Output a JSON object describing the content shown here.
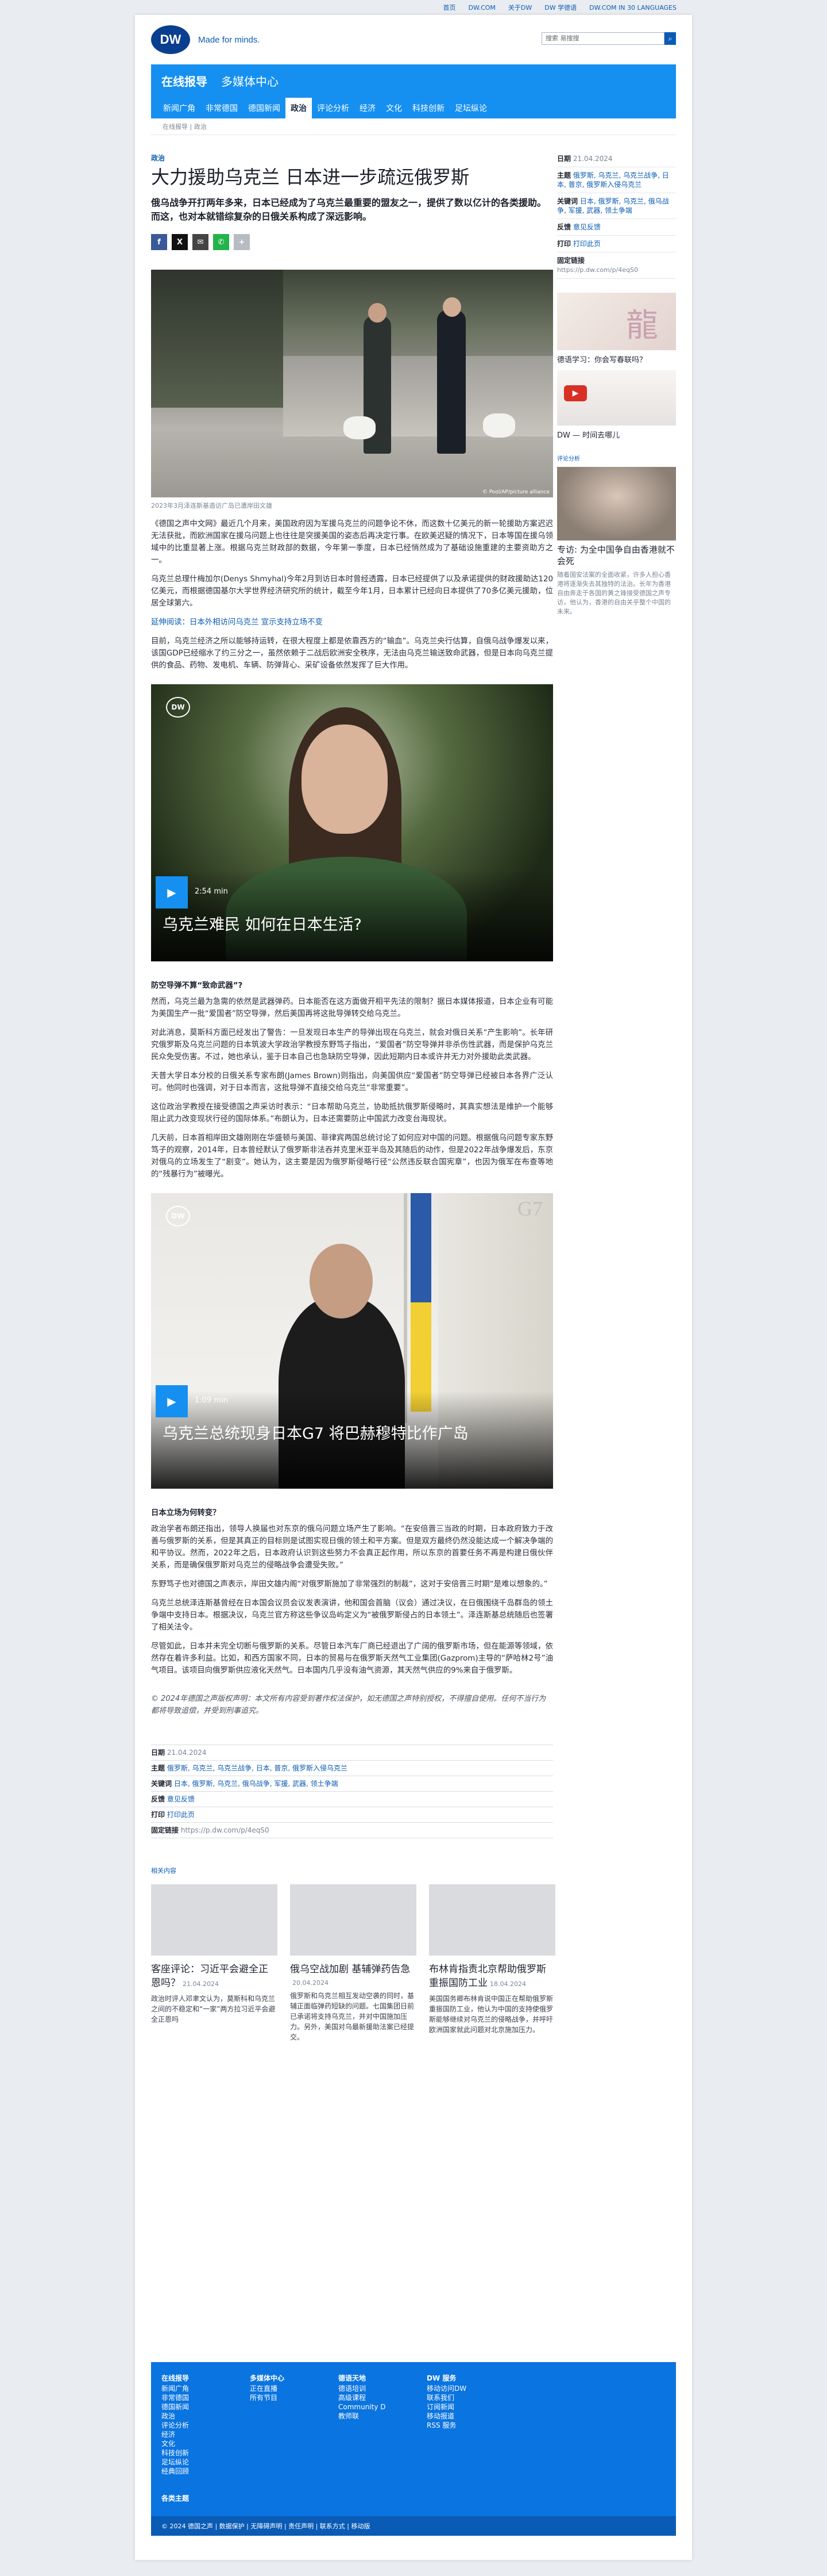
{
  "topbar": {
    "links": [
      "首页",
      "DW.COM",
      "关于DW",
      "DW 学德语",
      "DW.COM IN 30 LANGUAGES"
    ]
  },
  "header": {
    "logo": "DW",
    "slogan": "Made for minds.",
    "search_placeholder": "搜索 易搜搜"
  },
  "nav": {
    "brand": "在线报导",
    "brand_sub": "多媒体中心",
    "items": [
      "新闻广角",
      "非常德国",
      "德国新闻",
      "政治",
      "评论分析",
      "经济",
      "文化",
      "科技创新",
      "足坛纵论"
    ],
    "active": "政治"
  },
  "breadcrumb": {
    "path": "在线报导 | 政治"
  },
  "article": {
    "kicker": "政治",
    "title": "大力援助乌克兰 日本进一步疏远俄罗斯",
    "lead": "俄乌战争开打两年多来，日本已经成为了乌克兰最重要的盟友之一，提供了数以亿计的各类援助。而这，也对本就错综复杂的日俄关系构成了深远影响。",
    "share": [
      "f",
      "X",
      "✉",
      "✆",
      "+"
    ],
    "photo_credit": "© Pool/AP/picture alliance",
    "caption": "2023年3月泽连斯基造访广岛已遭岸田文雄",
    "paragraphs": [
      "《德国之声中文网》最近几个月来，美国政府因为军援乌克兰的问题争论不休，而这数十亿美元的新一轮援助方案迟迟无法获批，而欧洲国家在援乌问题上也往往是突援美国的姿态后再决定行事。在欧美迟疑的情况下，日本等国在援乌领域中的比重显著上涨。根据乌克兰财政部的数据，今年第一季度，日本已经悄然成为了基础设施重建的主要资助方之一。",
      "乌克兰总理什梅加尔(Denys Shmyhal)今年2月到访日本时曾经透露，日本已经提供了以及承诺提供的财政援助达120亿美元，而根据德国基尔大学世界经济研究所的统计，截至今年1月，日本累计已经向日本提供了70多亿美元援助，位居全球第六。",
      "延伸阅读：日本外相访问乌克兰 宣示支持立场不变",
      "目前，乌克兰经济之所以能够持运转，在很大程度上都是依靠西方的“输血”。乌克兰央行估算，自俄乌战争爆发以来，该国GDP已经缩水了约三分之一，虽然依赖于二战后欧洲安全秩序，无法由乌克兰输送致命武器，但是日本向乌克兰提供的食品、药物、发电机、车辆、防弹背心、采矿设备依然发挥了巨大作用。"
    ],
    "video1": {
      "duration": "2:54 min",
      "title": "乌克兰难民 如何在日本生活?"
    },
    "sub1": "防空导弹不算“致命武器”?",
    "paragraphs2": [
      "然而，乌克兰最为急需的依然是武器弹药。日本能否在这方面做开相平先法的限制？据日本媒体报道，日本企业有可能为美国生产一批“爱国者”防空导弹，然后美国再将这批导弹转交给乌克兰。",
      "对此消息，莫斯科方面已经发出了警告：一旦发现日本生产的导弹出现在乌克兰，就会对俄日关系“产生影响”。长年研究俄罗斯及乌克兰问题的日本筑波大学政治学教授东野笃子指出，“爱国者”防空导弹并非杀伤性武器，而是保护乌克兰民众免受伤害。不过，她也承认，鉴于日本自己也急缺防空导弹，因此短期内日本或许并无力对外援助此类武器。",
      "天普大学日本分校的日俄关系专家布朗(James Brown)则指出，向美国供应“爱国者”防空导弹已经被日本各界广泛认可。他同时也强调，对于日本而言，这批导弹不直接交给乌克兰“非常重要”。",
      "这位政治学教授在接受德国之声采访时表示：“日本帮助乌克兰，协助抵抗俄罗斯侵略时，其真实想法是维护一个能够阻止武力改变现状行径的国际体系。”布朗认为，日本还需要防止中国武力改变台海现状。",
      "几天前，日本首相岸田文雄刚刚在华盛顿与美国、菲律宾两国总统讨论了如何应对中国的问题。根据俄乌问题专家东野笃子的观察，2014年，日本曾经默认了俄罗斯非法吞并克里米亚半岛及其随后的动作，但是2022年战争爆发后，东京对俄乌的立场发生了“剧变”。她认为，这主要是因为俄罗斯侵略行径“公然违反联合国宪章”，也因为俄军在布查等地的“残暴行为”被曝光。"
    ],
    "video2": {
      "duration": "1:09 min",
      "title": "乌克兰总统现身日本G7 将巴赫穆特比作广岛"
    },
    "sub2": "日本立场为何转变？",
    "paragraphs3": [
      "政治学者布朗还指出，领导人换届也对东京的俄乌问题立场产生了影响。“在安倍晋三当政的时期，日本政府致力于改善与俄罗斯的关系，但是其真正的目标则是试图实现日俄的领土和平方案。但是双方最终仍然没能达成一个解决争端的和平协议。然而，2022年之后，日本政府认识到这些努力不会真正起作用，所以东京的首要任务不再是构建日俄伙伴关系，而是确保俄罗斯对乌克兰的侵略战争会遭受失败。”",
      "东野笃子也对德国之声表示，岸田文雄内阁“对俄罗斯施加了非常强烈的制裁”，这对于安倍晋三时期“是难以想象的。”",
      "乌克兰总统泽连斯基曾经在日本国会议员会议发表演讲，他和国会首脑（议会）通过决议，在日俄围绕千岛群岛的领土争端中支持日本。根据决议，乌克兰官方称这些争议岛屿定义为“被俄罗斯侵占的日本领土”。泽连斯基总统随后也签署了相关法令。",
      "尽管如此，日本并未完全切断与俄罗斯的关系。尽管日本汽车厂商已经退出了广阔的俄罗斯市场，但在能源等领域，依然存在着许多利益。比如，和西方国家不同，日本的贸易与在俄罗斯天然气工业集团(Gazprom)主导的“萨哈林2号”油气项目。该项目向俄罗斯供应液化天然气。日本国内几乎没有油气资源，其天然气供应的9%来自于俄罗斯。"
    ],
    "copyright": "© 2024年德国之声版权声明：本文所有内容受到著作权法保护，如无德国之声特别授权，不得擅自使用。任何不当行为都将导致追偿，并受到刑事追究。"
  },
  "meta": {
    "date_label": "日期",
    "date": "21.04.2024",
    "topics_label": "主题",
    "topics": "俄罗斯, 乌克兰, 乌克兰战争, 日本, 普京, 俄罗斯入侵乌克兰",
    "keywords_label": "关键词",
    "keywords": "日本, 俄罗斯, 乌克兰, 俄乌战争, 军援, 武器, 领土争端",
    "feedback_label": "反馈",
    "feedback": "意见反馈",
    "print_label": "打印",
    "print": "打印此页",
    "link_label": "固定链接",
    "link": "https://p.dw.com/p/4eqS0"
  },
  "related": {
    "title": "相关内容",
    "cards": [
      {
        "title": "客座评论：习近平会避全正恩吗？",
        "date": "21.04.2024",
        "body": "政治时评人邓聿文认为，莫斯科和乌克兰之间的不稳定和“一家”两方拉习近平会避全正恩吗"
      },
      {
        "title": "俄乌空战加剧 基辅弹药告急",
        "date": "20.04.2024",
        "body": "俄罗斯和乌克兰相互发动空袭的同时，基辅正面临弹药短缺的问题。七国集团日前已承诺将支持乌克兰，并对中国施加压力。另外，美国对乌最新援助法案已经提交。"
      },
      {
        "title": "布林肯指责北京帮助俄罗斯重振国防工业",
        "date": "18.04.2024",
        "body": "美国国务卿布林肯说中国正在帮助俄罗斯重振国防工业，他认为中国的支持使俄罗斯能够继续对乌克兰的侵略战争，并呼吁欧洲国家就此问题对北京施加压力。"
      }
    ]
  },
  "sidebar": {
    "date_label": "日期",
    "date": "21.04.2024",
    "topics_label": "主题",
    "topics": "俄罗斯, 乌克兰, 乌克兰战争, 日本, 普京, 俄罗斯入侵乌克兰",
    "keywords_label": "关键词",
    "keywords": "日本, 俄罗斯, 乌克兰, 俄乌战争, 军援, 武器, 领土争端",
    "feedback_label": "反馈",
    "feedback": "意见反馈",
    "print_label": "打印",
    "print": "打印此页",
    "link_label": "固定链接",
    "link": "https://p.dw.com/p/4eqS0",
    "promo1": "德语学习：你会写春联吗？",
    "promo2": "DW — 时间去哪儿",
    "ad_label": "评论分析",
    "promo3_title": "专访: 为全中国争自由香港就不会死",
    "promo3_body": "随着国安法案的全面收紧，许多人担心香港将逐渐失去其独特的法治。长年为香港自由奔走于各国的黄之锋接受德国之声专访，他认为，香港的自由关乎整个中国的未来。"
  },
  "footer": {
    "cols": [
      {
        "h": "在线报导",
        "items": [
          "新闻广角",
          "非常德国",
          "德国新闻",
          "政治",
          "评论分析",
          "经济",
          "文化",
          "科技创新",
          "足坛纵论",
          "经典回顾"
        ]
      },
      {
        "h": "多媒体中心",
        "items": [
          "正在直播",
          "所有节目"
        ]
      },
      {
        "h": "德语天地",
        "items": [
          "德语培训",
          "高级课程",
          "Community D",
          "教师联"
        ]
      },
      {
        "h": "DW 服务",
        "items": [
          "移动访问DW",
          "联系我们",
          "订阅新闻",
          "移动报道",
          "RSS 服务"
        ]
      }
    ],
    "misc": "各类主题",
    "copyright": "© 2024 德国之声 | 数据保护 | 无障碍声明 | 责任声明 | 联系方式 | 移动版"
  }
}
